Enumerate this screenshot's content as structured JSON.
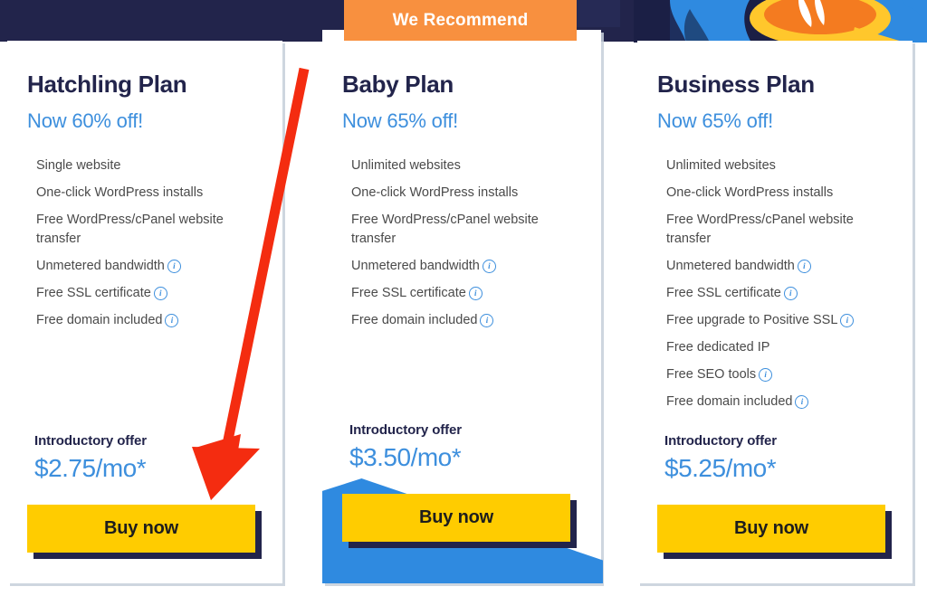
{
  "page": {
    "background_navy": "#22244b",
    "accent_blue": "#3d8fdd",
    "accent_yellow": "#ffcc00",
    "badge_orange": "#f8903f",
    "annotation_red": "#f42c10"
  },
  "badge": {
    "label": "We Recommend",
    "icon": "recommend-badge"
  },
  "illustration": {
    "name": "gecko-mascot-illustration",
    "colors": [
      "#2f8ae0",
      "#1b1f45",
      "#f47b20",
      "#ffc72c",
      "#ffffff"
    ]
  },
  "annotation": {
    "name": "red-arrow-pointer",
    "color": "#f42c10",
    "points_to": "hatchling-buy-now-button"
  },
  "plans": [
    {
      "id": "hatchling",
      "title": "Hatchling Plan",
      "discount": "Now 60% off!",
      "features": [
        {
          "text": "Single website",
          "info": false
        },
        {
          "text": "One-click WordPress installs",
          "info": false
        },
        {
          "text": "Free WordPress/cPanel website transfer",
          "info": false
        },
        {
          "text": "Unmetered bandwidth",
          "info": true
        },
        {
          "text": "Free SSL certificate",
          "info": true
        },
        {
          "text": "Free domain included",
          "info": true
        }
      ],
      "offer_label": "Introductory offer",
      "price": "$2.75/mo*",
      "cta": "Buy now",
      "recommended": false
    },
    {
      "id": "baby",
      "title": "Baby Plan",
      "discount": "Now 65% off!",
      "features": [
        {
          "text": "Unlimited websites",
          "info": false
        },
        {
          "text": "One-click WordPress installs",
          "info": false
        },
        {
          "text": "Free WordPress/cPanel website transfer",
          "info": false
        },
        {
          "text": "Unmetered bandwidth",
          "info": true
        },
        {
          "text": "Free SSL certificate",
          "info": true
        },
        {
          "text": "Free domain included",
          "info": true
        }
      ],
      "offer_label": "Introductory offer",
      "price": "$3.50/mo*",
      "cta": "Buy now",
      "recommended": true
    },
    {
      "id": "business",
      "title": "Business Plan",
      "discount": "Now 65% off!",
      "features": [
        {
          "text": "Unlimited websites",
          "info": false
        },
        {
          "text": "One-click WordPress installs",
          "info": false
        },
        {
          "text": "Free WordPress/cPanel website transfer",
          "info": false
        },
        {
          "text": "Unmetered bandwidth",
          "info": true
        },
        {
          "text": "Free SSL certificate",
          "info": true
        },
        {
          "text": "Free upgrade to Positive SSL",
          "info": true
        },
        {
          "text": "Free dedicated IP",
          "info": false
        },
        {
          "text": "Free SEO tools",
          "info": true
        },
        {
          "text": "Free domain included",
          "info": true
        }
      ],
      "offer_label": "Introductory offer",
      "price": "$5.25/mo*",
      "cta": "Buy now",
      "recommended": false
    }
  ],
  "info_icon_label": "i"
}
